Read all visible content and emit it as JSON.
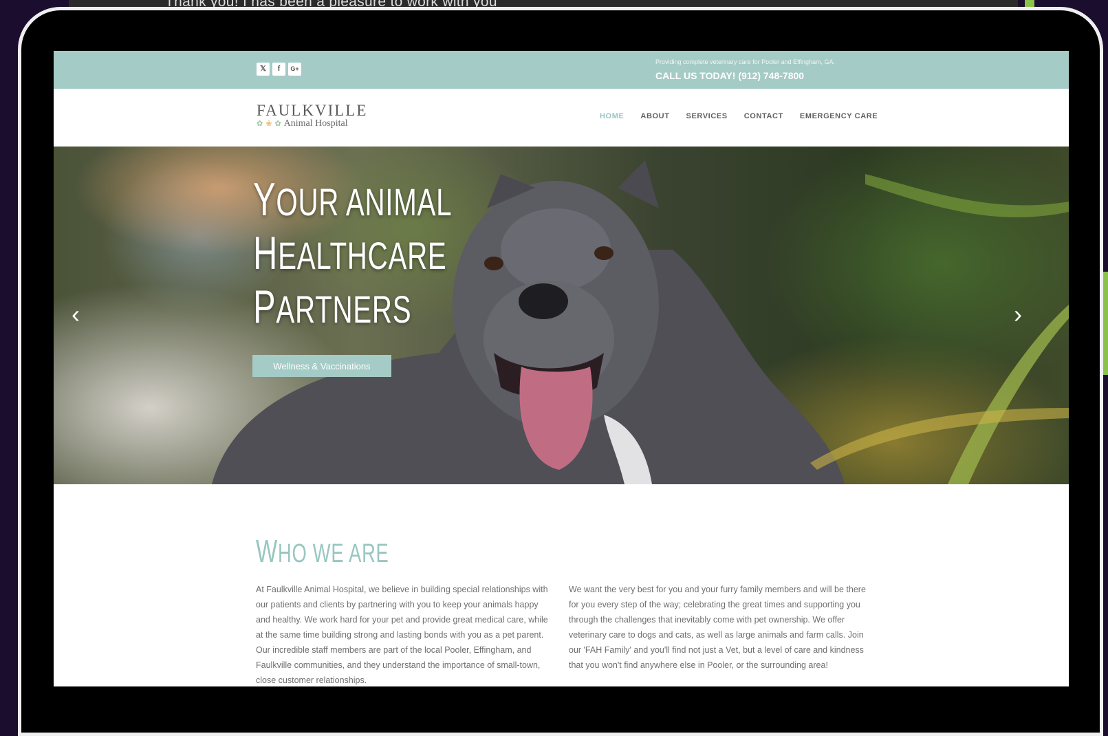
{
  "background": {
    "caption": "Thank you! I has been a pleasure to work with you",
    "accent_color": "#8bc34a",
    "device_color": "#000000"
  },
  "topbar": {
    "social_icons": [
      {
        "name": "twitter-icon",
        "glyph": "✓"
      },
      {
        "name": "facebook-icon",
        "glyph": "f"
      },
      {
        "name": "google-plus-icon",
        "glyph": "G+"
      }
    ],
    "tagline": "Providing complete veterinary care for Pooler and Effingham, GA.",
    "call_us": "CALL US TODAY! (912) 748-7800",
    "color": "#a5cbc6"
  },
  "header": {
    "logo_main": "FAULKVILLE",
    "logo_sub": "Animal Hospital",
    "nav": [
      {
        "label": "HOME",
        "active": true
      },
      {
        "label": "ABOUT",
        "active": false
      },
      {
        "label": "SERVICES",
        "active": false
      },
      {
        "label": "CONTACT",
        "active": false
      },
      {
        "label": "EMERGENCY CARE",
        "active": false
      }
    ]
  },
  "hero": {
    "title_lines": [
      "Your Animal",
      "Healthcare",
      "Partners"
    ],
    "button_label": "Wellness & Vaccinations",
    "prev_icon": "chevron-left-icon",
    "next_icon": "chevron-right-icon"
  },
  "about": {
    "title": "Who We Are",
    "title_color": "#98c7c1",
    "col1": "At Faulkville Animal Hospital, we believe in building special relationships with our patients and clients by partnering with you to keep your animals happy and healthy. We work hard for your pet and provide great medical care, while at the same time building strong and lasting bonds with you as a pet parent. Our incredible staff members are part of the local Pooler, Effingham, and Faulkville communities, and they understand the importance of small-town, close customer relationships.",
    "col2": "We want the very best for you and your furry family members and will be there for you every step of the way; celebrating the great times and supporting you through the challenges that inevitably come with pet ownership. We offer veterinary care to dogs and cats, as well as large animals and farm calls. Join our 'FAH Family' and you'll find not just a Vet, but a level of care and kindness that you won't find anywhere else in Pooler, or the surrounding area!"
  }
}
